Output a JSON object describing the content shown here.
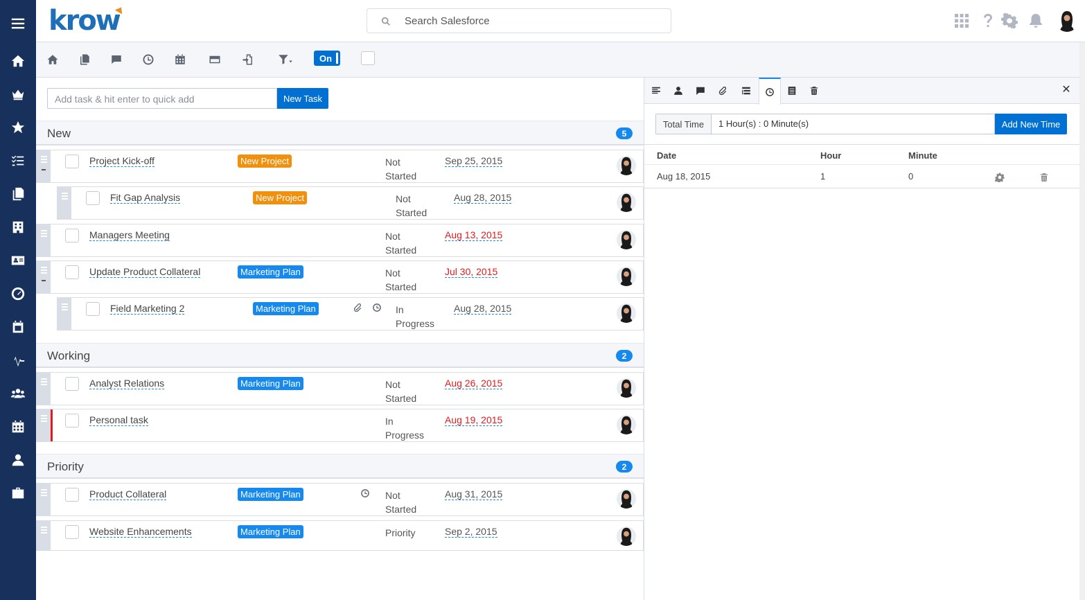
{
  "brand": {
    "logo_text": "krow"
  },
  "search": {
    "placeholder": "Search Salesforce"
  },
  "left_nav": [
    "menu-icon",
    "home-icon",
    "crown-icon",
    "star-icon",
    "task-list-icon",
    "documents-icon",
    "building-icon",
    "contact-card-icon",
    "dashboard-gauge-icon",
    "calendar-check-icon",
    "pulse-icon",
    "people-icon",
    "calendar-icon",
    "user-icon",
    "briefcase-icon"
  ],
  "header_icons": [
    "app-launcher-icon",
    "help-icon",
    "settings-icon",
    "notification-bell-icon",
    "user-avatar"
  ],
  "toolbar": {
    "icons": [
      "home-icon",
      "documents-icon",
      "comment-icon",
      "clock-icon",
      "calendar-icon",
      "card-icon",
      "export-icon",
      "filter-icon"
    ],
    "toggle_label": "On"
  },
  "quick_add": {
    "placeholder": "Add task & hit enter to quick add",
    "button_label": "New Task"
  },
  "sections": [
    {
      "title": "New",
      "count": "5"
    },
    {
      "title": "Working",
      "count": "2"
    },
    {
      "title": "Priority",
      "count": "2"
    }
  ],
  "tasks": [
    {
      "name": "Project Kick-off",
      "tag": "New Project",
      "status": "Not Started",
      "date": "Sep 25, 2015"
    },
    {
      "name": "Fit Gap Analysis",
      "tag": "New Project",
      "status": "Not Started",
      "date": "Aug 28, 2015"
    },
    {
      "name": "Managers Meeting",
      "tag": "",
      "status": "Not Started",
      "date": "Aug 13, 2015"
    },
    {
      "name": "Update Product Collateral",
      "tag": "Marketing Plan",
      "status": "Not Started",
      "date": "Jul 30, 2015"
    },
    {
      "name": "Field Marketing 2",
      "tag": "Marketing Plan",
      "status": "In Progress",
      "date": "Aug 28, 2015"
    },
    {
      "name": "Analyst Relations",
      "tag": "Marketing Plan",
      "status": "Not Started",
      "date": "Aug 26, 2015"
    },
    {
      "name": "Personal task",
      "tag": "",
      "status": "In Progress",
      "date": "Aug 19, 2015"
    },
    {
      "name": "Product Collateral",
      "tag": "Marketing Plan",
      "status": "Not Started",
      "date": "Aug 31, 2015"
    },
    {
      "name": "Website Enhancements",
      "tag": "Marketing Plan",
      "status": "Priority",
      "date": "Sep 2, 2015"
    }
  ],
  "colors": {
    "accent": "#0070d2",
    "nav": "#17315c",
    "overdue": "#e41b1b",
    "tag_orange": "#f0900c",
    "tag_blue": "#1589ee"
  },
  "detail": {
    "tabs": [
      "details-icon",
      "user-icon",
      "comment-icon",
      "attachment-icon",
      "list-icon",
      "clock-icon",
      "notes-icon",
      "trash-icon"
    ],
    "active_tab": "clock-icon",
    "total_time_label": "Total Time",
    "total_time_value": "1 Hour(s) : 0 Minute(s)",
    "add_button": "Add New Time",
    "columns": [
      "Date",
      "Hour",
      "Minute"
    ],
    "entries": [
      {
        "date": "Aug 18, 2015",
        "hour": "1",
        "minute": "0"
      }
    ]
  }
}
